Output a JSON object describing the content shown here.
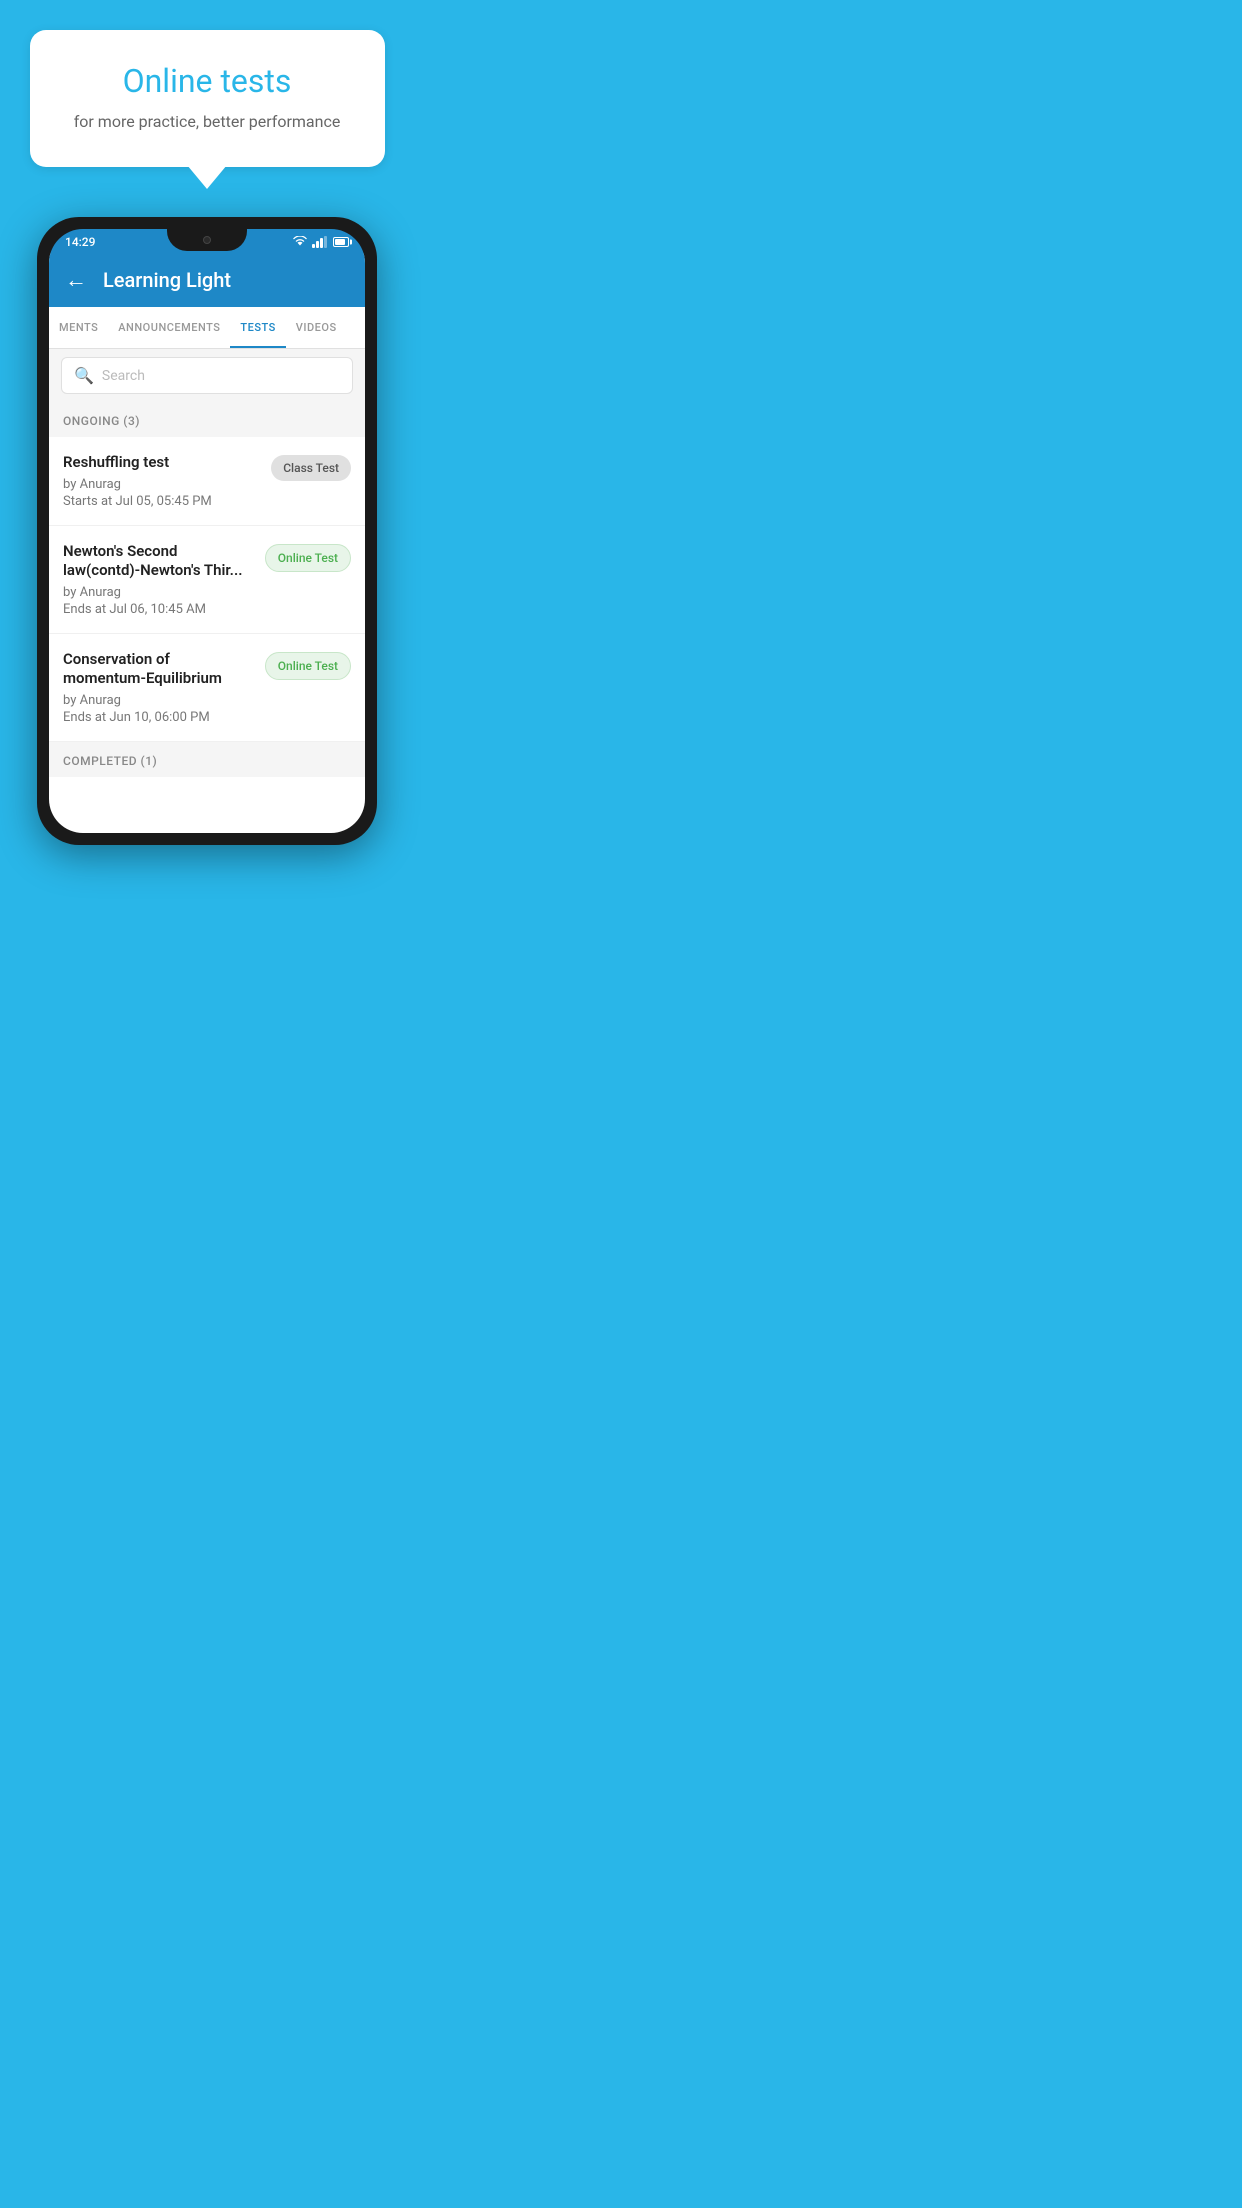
{
  "background_color": "#29B6E8",
  "speech_bubble": {
    "title": "Online tests",
    "subtitle": "for more practice, better performance"
  },
  "status_bar": {
    "time": "14:29",
    "wifi": true,
    "signal": true,
    "battery": true
  },
  "app_bar": {
    "back_icon": "←",
    "title": "Learning Light"
  },
  "tabs": [
    {
      "label": "MENTS",
      "active": false
    },
    {
      "label": "ANNOUNCEMENTS",
      "active": false
    },
    {
      "label": "TESTS",
      "active": true
    },
    {
      "label": "VIDEOS",
      "active": false
    }
  ],
  "search": {
    "placeholder": "Search",
    "search_icon": "🔍"
  },
  "ongoing_section": {
    "label": "ONGOING (3)",
    "tests": [
      {
        "title": "Reshuffling test",
        "by": "by Anurag",
        "date": "Starts at  Jul 05, 05:45 PM",
        "badge": "Class Test",
        "badge_type": "class"
      },
      {
        "title": "Newton's Second law(contd)-Newton's Thir...",
        "by": "by Anurag",
        "date": "Ends at  Jul 06, 10:45 AM",
        "badge": "Online Test",
        "badge_type": "online"
      },
      {
        "title": "Conservation of momentum-Equilibrium",
        "by": "by Anurag",
        "date": "Ends at  Jun 10, 06:00 PM",
        "badge": "Online Test",
        "badge_type": "online"
      }
    ]
  },
  "completed_section": {
    "label": "COMPLETED (1)"
  }
}
